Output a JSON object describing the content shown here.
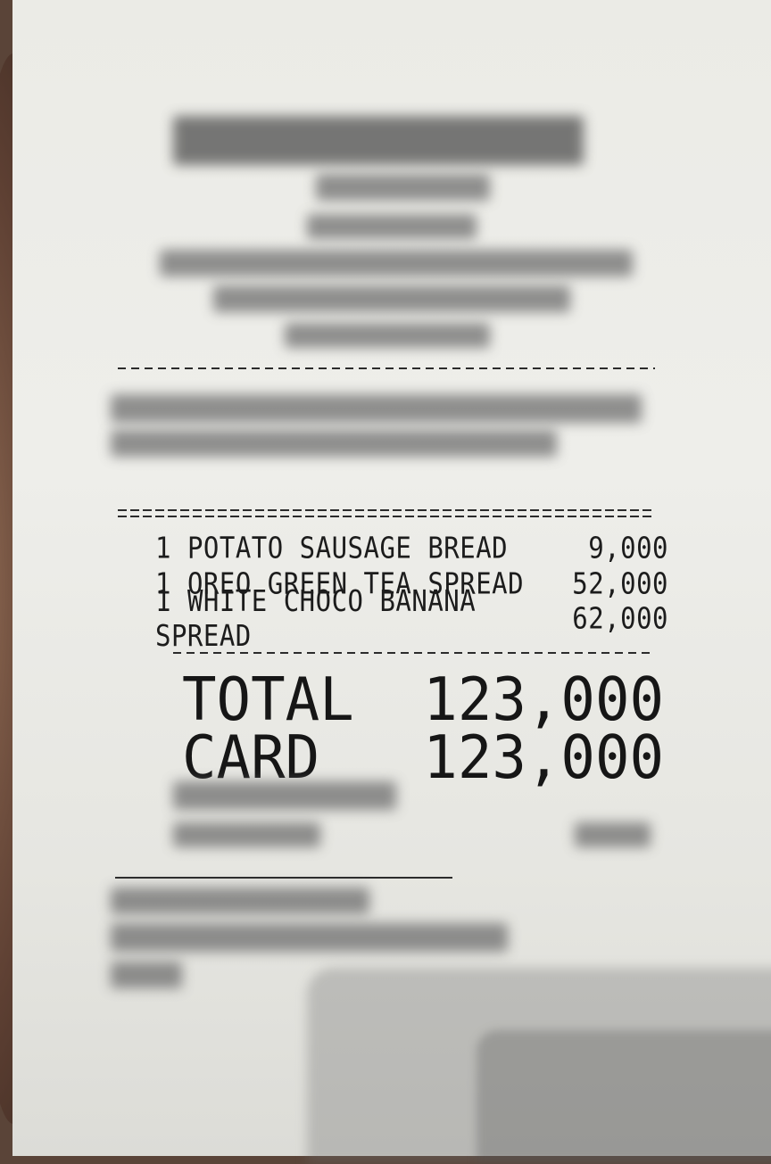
{
  "receipt": {
    "items": [
      {
        "qty": "1",
        "name": "POTATO SAUSAGE BREAD",
        "price": "9,000"
      },
      {
        "qty": "1",
        "name": "OREO GREEN TEA SPREAD",
        "price": "52,000"
      },
      {
        "qty": "1",
        "name": "WHITE CHOCO BANANA SPREAD",
        "price": "62,000"
      }
    ],
    "total_label": "TOTAL",
    "total_value": "123,000",
    "card_label": "CARD",
    "card_value": "123,000"
  }
}
